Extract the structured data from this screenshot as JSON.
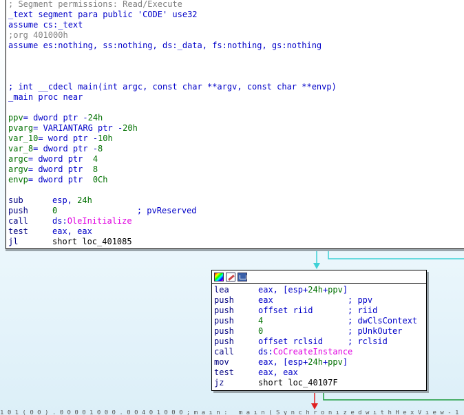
{
  "block1": {
    "lines": [
      {
        "parts": [
          {
            "t": "; Segment permissions: Read/Execute",
            "c": "comment"
          }
        ]
      },
      {
        "parts": [
          {
            "t": "_text segment para public 'CODE' use32",
            "c": "blue"
          }
        ]
      },
      {
        "parts": [
          {
            "t": "assume cs:_text",
            "c": "blue"
          }
        ]
      },
      {
        "parts": [
          {
            "t": ";org 401000h",
            "c": "comment"
          }
        ]
      },
      {
        "parts": [
          {
            "t": "assume es:nothing, ss:nothing, ds:_data, fs:nothing, gs:nothing",
            "c": "blue"
          }
        ]
      },
      {
        "parts": []
      },
      {
        "parts": []
      },
      {
        "parts": []
      },
      {
        "parts": [
          {
            "t": "; int __cdecl main(int argc, const char **argv, const char **envp)",
            "c": "blue"
          }
        ]
      },
      {
        "parts": [
          {
            "t": "_main proc near",
            "c": "blue"
          }
        ]
      },
      {
        "parts": []
      },
      {
        "parts": [
          {
            "t": "ppv",
            "c": "green"
          },
          {
            "t": "= dword ptr -",
            "c": "blue"
          },
          {
            "t": "24h",
            "c": "green"
          }
        ]
      },
      {
        "parts": [
          {
            "t": "pvarg",
            "c": "green"
          },
          {
            "t": "= VARIANTARG ptr -",
            "c": "blue"
          },
          {
            "t": "20h",
            "c": "green"
          }
        ]
      },
      {
        "parts": [
          {
            "t": "var_10",
            "c": "green"
          },
          {
            "t": "= word ptr -",
            "c": "blue"
          },
          {
            "t": "10h",
            "c": "green"
          }
        ]
      },
      {
        "parts": [
          {
            "t": "var_8",
            "c": "green"
          },
          {
            "t": "= dword ptr -",
            "c": "blue"
          },
          {
            "t": "8",
            "c": "green"
          }
        ]
      },
      {
        "parts": [
          {
            "t": "argc",
            "c": "green"
          },
          {
            "t": "= dword ptr  ",
            "c": "blue"
          },
          {
            "t": "4",
            "c": "green"
          }
        ]
      },
      {
        "parts": [
          {
            "t": "argv",
            "c": "green"
          },
          {
            "t": "= dword ptr  ",
            "c": "blue"
          },
          {
            "t": "8",
            "c": "green"
          }
        ]
      },
      {
        "parts": [
          {
            "t": "envp",
            "c": "green"
          },
          {
            "t": "= dword ptr  ",
            "c": "blue"
          },
          {
            "t": "0Ch",
            "c": "green"
          }
        ]
      },
      {
        "parts": []
      },
      {
        "mn": "sub",
        "parts": [
          {
            "t": "esp, ",
            "c": "blue"
          },
          {
            "t": "24h",
            "c": "green"
          }
        ]
      },
      {
        "mn": "push",
        "parts": [
          {
            "t": "0                ",
            "c": "green"
          },
          {
            "t": "; pvReserved",
            "c": "blue"
          }
        ]
      },
      {
        "mn": "call",
        "parts": [
          {
            "t": "ds:",
            "c": "blue"
          },
          {
            "t": "OleInitialize",
            "c": "magenta"
          }
        ]
      },
      {
        "mn": "test",
        "parts": [
          {
            "t": "eax, eax",
            "c": "blue"
          }
        ]
      },
      {
        "mn": "jl",
        "parts": [
          {
            "t": "short loc_401085",
            "c": "black"
          }
        ]
      }
    ]
  },
  "block2": {
    "toolbar_icons": [
      "color-palette-icon",
      "edit-node-icon",
      "graph-view-icon"
    ],
    "lines": [
      {
        "mn": "lea",
        "ops": [
          {
            "t": "eax, [esp+",
            "c": "blue"
          },
          {
            "t": "24h",
            "c": "green"
          },
          {
            "t": "+",
            "c": "blue"
          },
          {
            "t": "ppv",
            "c": "green"
          },
          {
            "t": "]",
            "c": "blue"
          }
        ],
        "cm": ""
      },
      {
        "mn": "push",
        "ops": [
          {
            "t": "eax",
            "c": "blue"
          }
        ],
        "cm": "; ppv"
      },
      {
        "mn": "push",
        "ops": [
          {
            "t": "offset riid",
            "c": "blue"
          }
        ],
        "cm": "; riid"
      },
      {
        "mn": "push",
        "ops": [
          {
            "t": "4",
            "c": "green"
          }
        ],
        "cm": "; dwClsContext"
      },
      {
        "mn": "push",
        "ops": [
          {
            "t": "0",
            "c": "green"
          }
        ],
        "cm": "; pUnkOuter"
      },
      {
        "mn": "push",
        "ops": [
          {
            "t": "offset rclsid",
            "c": "blue"
          }
        ],
        "cm": "; rclsid"
      },
      {
        "mn": "call",
        "ops": [
          {
            "t": "ds:",
            "c": "blue"
          },
          {
            "t": "CoCreateInstance",
            "c": "magenta"
          }
        ],
        "cm": ""
      },
      {
        "mn": "mov",
        "ops": [
          {
            "t": "eax, [esp+",
            "c": "blue"
          },
          {
            "t": "24h",
            "c": "green"
          },
          {
            "t": "+",
            "c": "blue"
          },
          {
            "t": "ppv",
            "c": "green"
          },
          {
            "t": "]",
            "c": "blue"
          }
        ],
        "cm": ""
      },
      {
        "mn": "test",
        "ops": [
          {
            "t": "eax, eax",
            "c": "blue"
          }
        ],
        "cm": ""
      },
      {
        "mn": "jz",
        "ops": [
          {
            "t": "short loc_40107F",
            "c": "black"
          }
        ],
        "cm": ""
      }
    ]
  },
  "status_strip": "1 0 1 ( 0 0 ) . 0 0 0 0 1 0 0 0 . 0 0 4 0 1 0 0 0 ; m a i n : _ m a i n ( S y n c h r o n i z e d   w i t h   H e x   V i e w - 1 )",
  "colors": {
    "edge_unconditional": "#3dd1d6",
    "edge_true": "#1d9b3c",
    "edge_false": "#e02020"
  }
}
